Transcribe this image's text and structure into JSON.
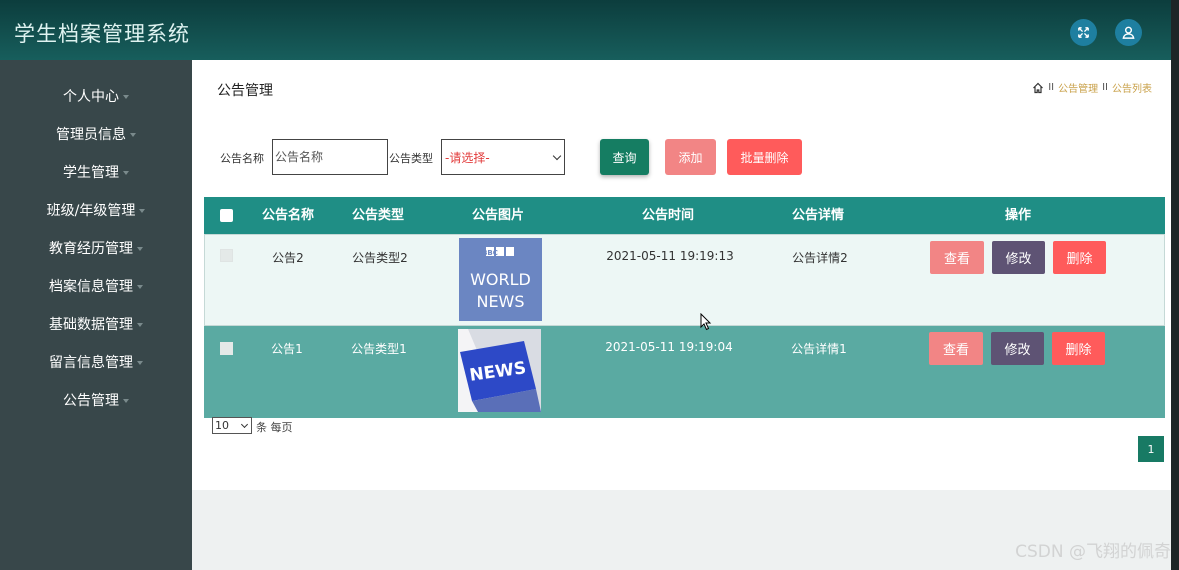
{
  "app": {
    "title": "学生档案管理系统"
  },
  "sidebar": {
    "items": [
      {
        "label": "个人中心"
      },
      {
        "label": "管理员信息"
      },
      {
        "label": "学生管理"
      },
      {
        "label": "班级/年级管理"
      },
      {
        "label": "教育经历管理"
      },
      {
        "label": "档案信息管理"
      },
      {
        "label": "基础数据管理"
      },
      {
        "label": "留言信息管理"
      },
      {
        "label": "公告管理"
      }
    ]
  },
  "page": {
    "title": "公告管理",
    "breadcrumb": {
      "sep": "II",
      "items": [
        "公告管理",
        "公告列表"
      ]
    }
  },
  "search": {
    "name_label": "公告名称",
    "name_placeholder": "公告名称",
    "type_label": "公告类型",
    "type_selected": "-请选择-",
    "query_button": "查询",
    "add_button": "添加",
    "batch_delete_button": "批量删除"
  },
  "table": {
    "columns": [
      "公告名称",
      "公告类型",
      "公告图片",
      "公告时间",
      "公告详情",
      "操作"
    ],
    "rows": [
      {
        "name": "公告2",
        "type": "公告类型2",
        "image": "bbc-world-news-image",
        "image_text": [
          "BBC",
          "WORLD",
          "NEWS"
        ],
        "time": "2021-05-11 19:19:13",
        "detail": "公告详情2"
      },
      {
        "name": "公告1",
        "type": "公告类型1",
        "image": "news-key-image",
        "image_text": [
          "NEWS"
        ],
        "time": "2021-05-11 19:19:04",
        "detail": "公告详情1"
      }
    ],
    "actions": {
      "view": "查看",
      "edit": "修改",
      "delete": "删除"
    }
  },
  "pagination": {
    "page_size": "10",
    "per_page_label": "条 每页",
    "current_page": "1"
  },
  "watermark": "CSDN @飞翔的佩奇",
  "colors": {
    "header": "#175e5c",
    "sidebar": "#38474a",
    "table_header": "#1f8e85",
    "row_selected": "#5aaaa2",
    "primary_button": "#157d62",
    "danger": "#ff5b5b",
    "edit": "#5e5374"
  }
}
